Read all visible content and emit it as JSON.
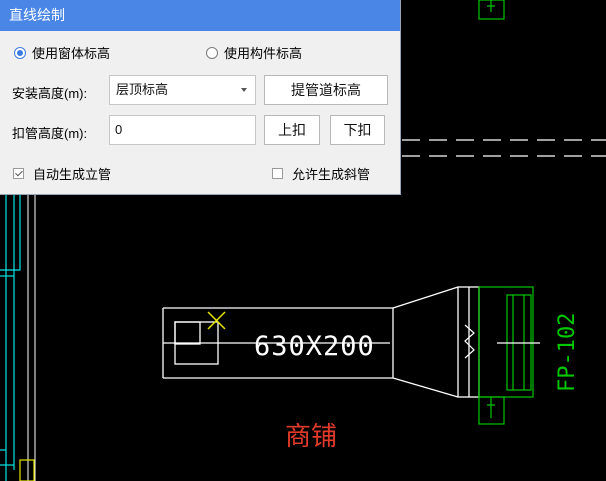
{
  "dialog": {
    "title": "直线绘制",
    "mode_options": [
      {
        "label": "使用窗体标高",
        "selected": true
      },
      {
        "label": "使用构件标高",
        "selected": false
      }
    ],
    "install_height": {
      "label": "安装高度(m):",
      "value": "层顶标高"
    },
    "pipe_height_button": "提管道标高",
    "offset_height": {
      "label": "扣管高度(m):",
      "value": "0"
    },
    "up_button": "上扣",
    "down_button": "下扣",
    "auto_riser": {
      "label": "自动生成立管",
      "checked": true
    },
    "allow_slope": {
      "label": "允许生成斜管",
      "checked": false
    }
  },
  "drawing": {
    "duct_size_label": "630X200",
    "equipment_label": "FP-102",
    "room_label": "商铺",
    "colors": {
      "lines": "#ffffff",
      "cyan": "#00e5e5",
      "green": "#00c800",
      "yellow": "#e6e600",
      "red": "#e23a2a"
    }
  }
}
